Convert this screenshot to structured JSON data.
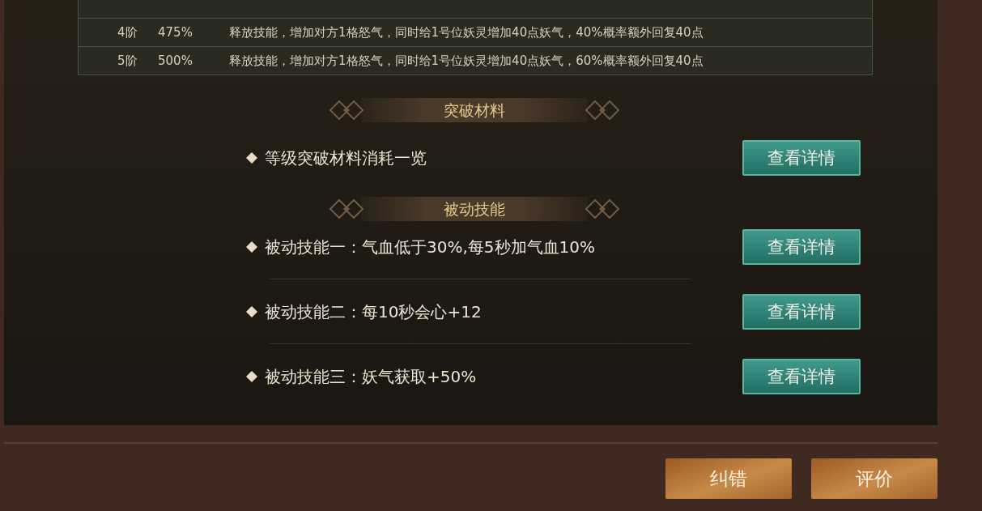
{
  "table": {
    "rows": [
      {
        "stage": "4阶",
        "percent": "475%",
        "effect": "释放技能，增加对方1格怒气，同时给1号位妖灵增加40点妖气，40%概率额外回复40点"
      },
      {
        "stage": "5阶",
        "percent": "500%",
        "effect": "释放技能，增加对方1格怒气，同时给1号位妖灵增加40点妖气，60%概率额外回复40点"
      }
    ]
  },
  "sections": [
    {
      "title": "突破材料",
      "items": [
        {
          "text": "等级突破材料消耗一览",
          "button": "查看详情"
        }
      ]
    },
    {
      "title": "被动技能",
      "items": [
        {
          "text": "被动技能一：气血低于30%,每5秒加气血10%",
          "button": "查看详情"
        },
        {
          "text": "被动技能二：每10秒会心+12",
          "button": "查看详情"
        },
        {
          "text": "被动技能三：妖气获取+50%",
          "button": "查看详情"
        }
      ]
    }
  ],
  "footer_buttons": [
    "纠错",
    "评价"
  ]
}
